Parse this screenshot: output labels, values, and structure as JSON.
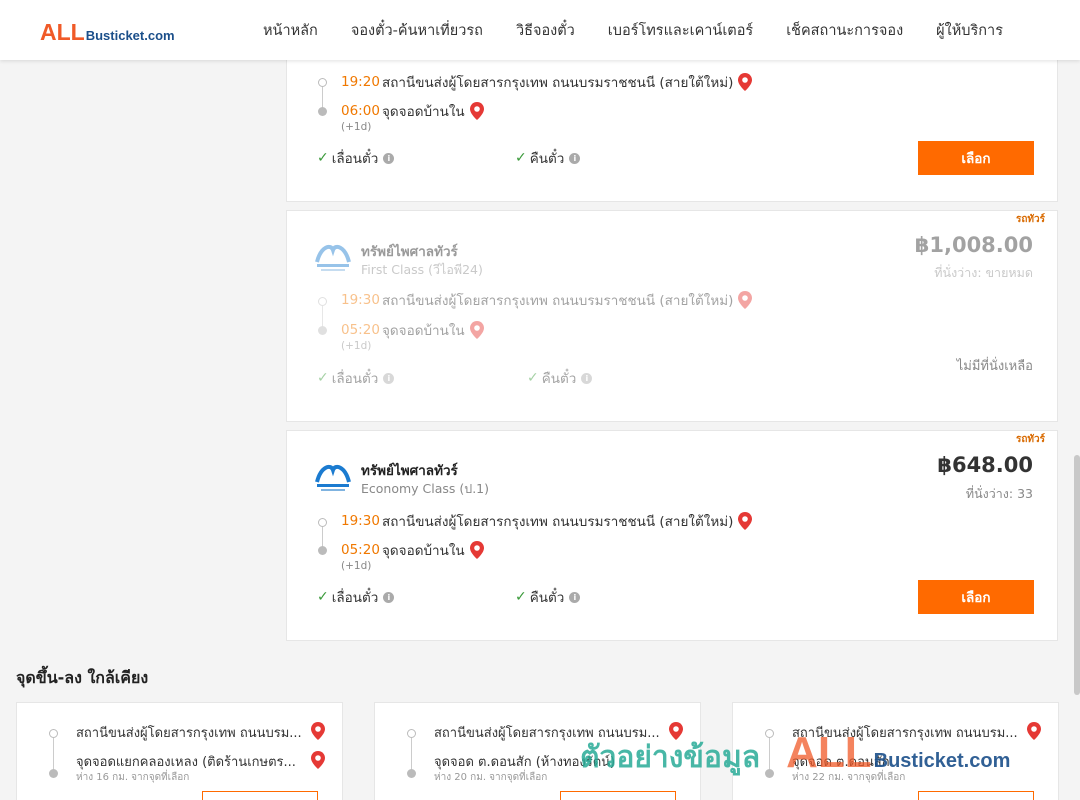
{
  "header": {
    "logo_all": "ALL",
    "logo_rest": "Busticket.com",
    "nav": [
      "หน้าหลัก",
      "จองตั๋ว-ค้นหาเที่ยวรถ",
      "วิธีจองตั๋ว",
      "เบอร์โทรและเคาน์เตอร์",
      "เช็คสถานะการจอง",
      "ผู้ให้บริการ"
    ]
  },
  "cards": [
    {
      "depart_time": "19:20",
      "depart_place": "สถานีขนส่งผู้โดยสารกรุงเทพ ถนนบรมราชชนนี (สายใต้ใหม่)",
      "arrive_time": "06:00",
      "arrive_place": "จุดจอดบ้านใน",
      "next_day": "(+1d)",
      "feature1": "เลื่อนตั๋ว",
      "feature2": "คืนตั๋ว",
      "button": "เลือก"
    },
    {
      "tag": "รถทัวร์",
      "operator": "ทรัพย์ไพศาลทัวร์",
      "class": "First Class (วีไอพี24)",
      "price": "฿1,008.00",
      "seats": "ที่นั่งว่าง: ขายหมด",
      "depart_time": "19:30",
      "depart_place": "สถานีขนส่งผู้โดยสารกรุงเทพ ถนนบรมราชชนนี (สายใต้ใหม่)",
      "arrive_time": "05:20",
      "arrive_place": "จุดจอดบ้านใน",
      "next_day": "(+1d)",
      "feature1": "เลื่อนตั๋ว",
      "feature2": "คืนตั๋ว",
      "no_seat": "ไม่มีที่นั่งเหลือ"
    },
    {
      "tag": "รถทัวร์",
      "operator": "ทรัพย์ไพศาลทัวร์",
      "class": "Economy Class (ป.1)",
      "price": "฿648.00",
      "seats": "ที่นั่งว่าง: 33",
      "depart_time": "19:30",
      "depart_place": "สถานีขนส่งผู้โดยสารกรุงเทพ ถนนบรมราชชนนี (สายใต้ใหม่)",
      "arrive_time": "05:20",
      "arrive_place": "จุดจอดบ้านใน",
      "next_day": "(+1d)",
      "feature1": "เลื่อนตั๋ว",
      "feature2": "คืนตั๋ว",
      "button": "เลือก"
    }
  ],
  "nearby": {
    "title": "จุดขึ้น-ลง ใกล้เคียง",
    "items": [
      {
        "from": "สถานีขนส่งผู้โดยสารกรุงเทพ ถนนบรม...",
        "to": "จุดจอดแยกคลองเหลง (ติดร้านเกษตร...",
        "dist": "ห่าง 16 กม. จากจุดที่เลือก"
      },
      {
        "from": "สถานีขนส่งผู้โดยสารกรุงเทพ ถนนบรม...",
        "to": "จุดจอด ต.ดอนสัก (ห้างทองรัตน์)",
        "dist": "ห่าง 20 กม. จากจุดที่เลือก"
      },
      {
        "from": "สถานีขนส่งผู้โดยสารกรุงเทพ ถนนบรม...",
        "to": "จุดจอด ต.ดอนสัก",
        "dist": "ห่าง 22 กม. จากจุดที่เลือก"
      }
    ]
  },
  "watermark": {
    "thai": "ตัวอย่างข้อมูล",
    "all": "ALL",
    "rest": "Busticket.com"
  },
  "colors": {
    "accent": "#ff6a00",
    "time": "#f07800",
    "check": "#3a9a3a",
    "pin": "#e53935",
    "logo_orange": "#f05a28",
    "logo_blue": "#1b4f8a"
  }
}
